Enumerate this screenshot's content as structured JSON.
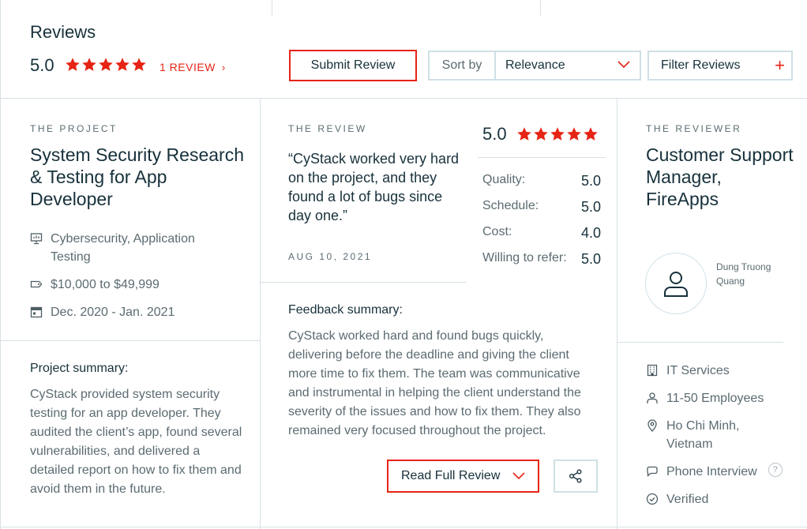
{
  "header": {
    "title": "Reviews",
    "rating": "5.0",
    "review_count": "1 REVIEW",
    "review_count_chevron": "›",
    "submit_label": "Submit Review",
    "sort_label": "Sort by",
    "sort_value": "Relevance",
    "filter_label": "Filter Reviews",
    "filter_plus": "+"
  },
  "project": {
    "eyebrow": "THE PROJECT",
    "title": "System Security Research & Testing for App Developer",
    "service": "Cybersecurity, Application Testing",
    "budget": "$10,000 to $49,999",
    "dates": "Dec. 2020 - Jan. 2021",
    "summary_label": "Project summary:",
    "summary": "CyStack provided system security testing for an app developer. They audited the client’s app, found several vulnerabilities, and delivered a detailed report on how to fix them and avoid them in the future."
  },
  "review": {
    "eyebrow": "THE REVIEW",
    "quote": "“CyStack worked very hard on the project, and they found a lot of bugs since day one.”",
    "date": "AUG 10, 2021",
    "overall": "5.0",
    "stars": 5,
    "scores": [
      {
        "label": "Quality:",
        "value": "5.0"
      },
      {
        "label": "Schedule:",
        "value": "5.0"
      },
      {
        "label": "Cost:",
        "value": "4.0"
      },
      {
        "label": "Willing to refer:",
        "value": "5.0"
      }
    ],
    "feedback_label": "Feedback summary:",
    "feedback": "CyStack worked hard and found bugs quickly, delivering before the deadline and giving the client more time to fix them. The team was communicative and instrumental in helping the client understand the severity of the issues and how to fix them. They also remained very focused throughout the project.",
    "read_full_label": "Read Full Review"
  },
  "reviewer": {
    "eyebrow": "THE REVIEWER",
    "title": "Customer Support Manager, FireApps",
    "name": "Dung Truong Quang",
    "industry": "IT Services",
    "company_size": "11-50 Employees",
    "location": "Ho Chi Minh, Vietnam",
    "interview_type": "Phone Interview",
    "help_mark": "?",
    "verified": "Verified"
  },
  "colors": {
    "accent": "#e62415",
    "text": "#17313b",
    "muted": "#5b6b71",
    "border": "#cfe0e6"
  }
}
